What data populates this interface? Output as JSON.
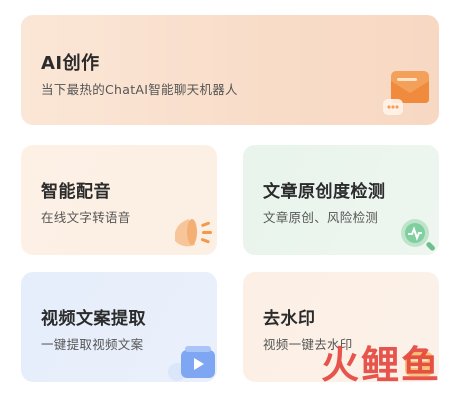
{
  "cards": {
    "ai": {
      "title": "AI创作",
      "subtitle": "当下最热的ChatAI智能聊天机器人",
      "icon": "chat-envelope-icon"
    },
    "dub": {
      "title": "智能配音",
      "subtitle": "在线文字转语音",
      "icon": "megaphone-icon"
    },
    "orig": {
      "title": "文章原创度检测",
      "subtitle": "文章原创、风险检测",
      "icon": "magnifier-check-icon"
    },
    "video": {
      "title": "视频文案提取",
      "subtitle": "一键提取视频文案",
      "icon": "video-play-icon"
    },
    "wm": {
      "title": "去水印",
      "subtitle": "视频一键去水印",
      "icon": "watermark-remove-icon"
    }
  },
  "watermark": "火鲤鱼",
  "colors": {
    "ai_bg": "#f8dcc8",
    "dub_bg": "#fdf1e6",
    "orig_bg": "#e8f4ec",
    "video_bg": "#e6eefb",
    "wm_bg": "#fcf0e6",
    "watermark": "#e4443b"
  }
}
